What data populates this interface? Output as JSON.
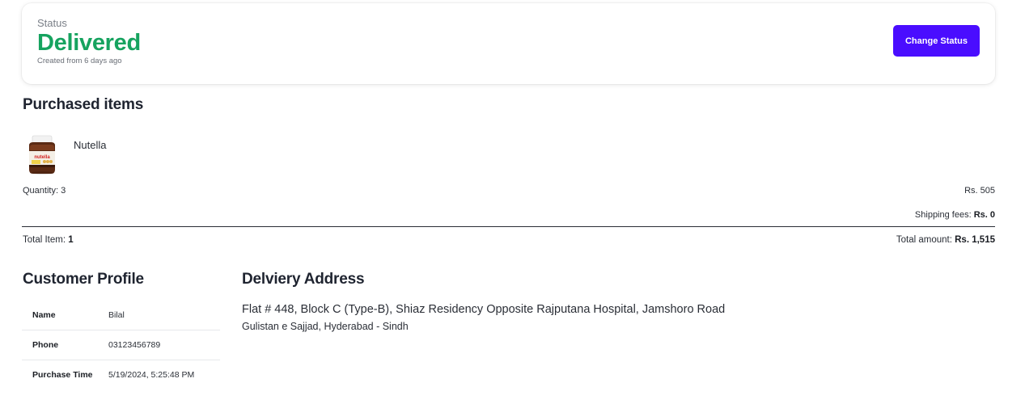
{
  "status": {
    "label": "Status",
    "value": "Delivered",
    "created": "Created from 6 days ago",
    "change_button": "Change Status",
    "value_color": "#16a35f",
    "button_color": "#4a0dff"
  },
  "purchased": {
    "title": "Purchased items",
    "items": [
      {
        "name": "Nutella",
        "thumbnail_icon": "nutella-jar-icon",
        "quantity": "Quantity: 3",
        "price": "Rs. 505"
      }
    ],
    "shipping_label": "Shipping fees: ",
    "shipping_value": "Rs. 0",
    "total_item_label": "Total Item: ",
    "total_item_value": "1",
    "total_amount_label": "Total amount: ",
    "total_amount_value": "Rs. 1,515"
  },
  "customer": {
    "title": "Customer Profile",
    "rows": [
      {
        "key": "Name",
        "value": "Bilal"
      },
      {
        "key": "Phone",
        "value": "03123456789"
      },
      {
        "key": "Purchase Time",
        "value": "5/19/2024, 5:25:48 PM"
      }
    ]
  },
  "delivery": {
    "title": "Delviery Address",
    "line1": "Flat # 448, Block C (Type-B), Shiaz Residency Opposite Rajputana Hospital, Jamshoro Road",
    "line2": "Gulistan e Sajjad, Hyderabad - Sindh"
  }
}
